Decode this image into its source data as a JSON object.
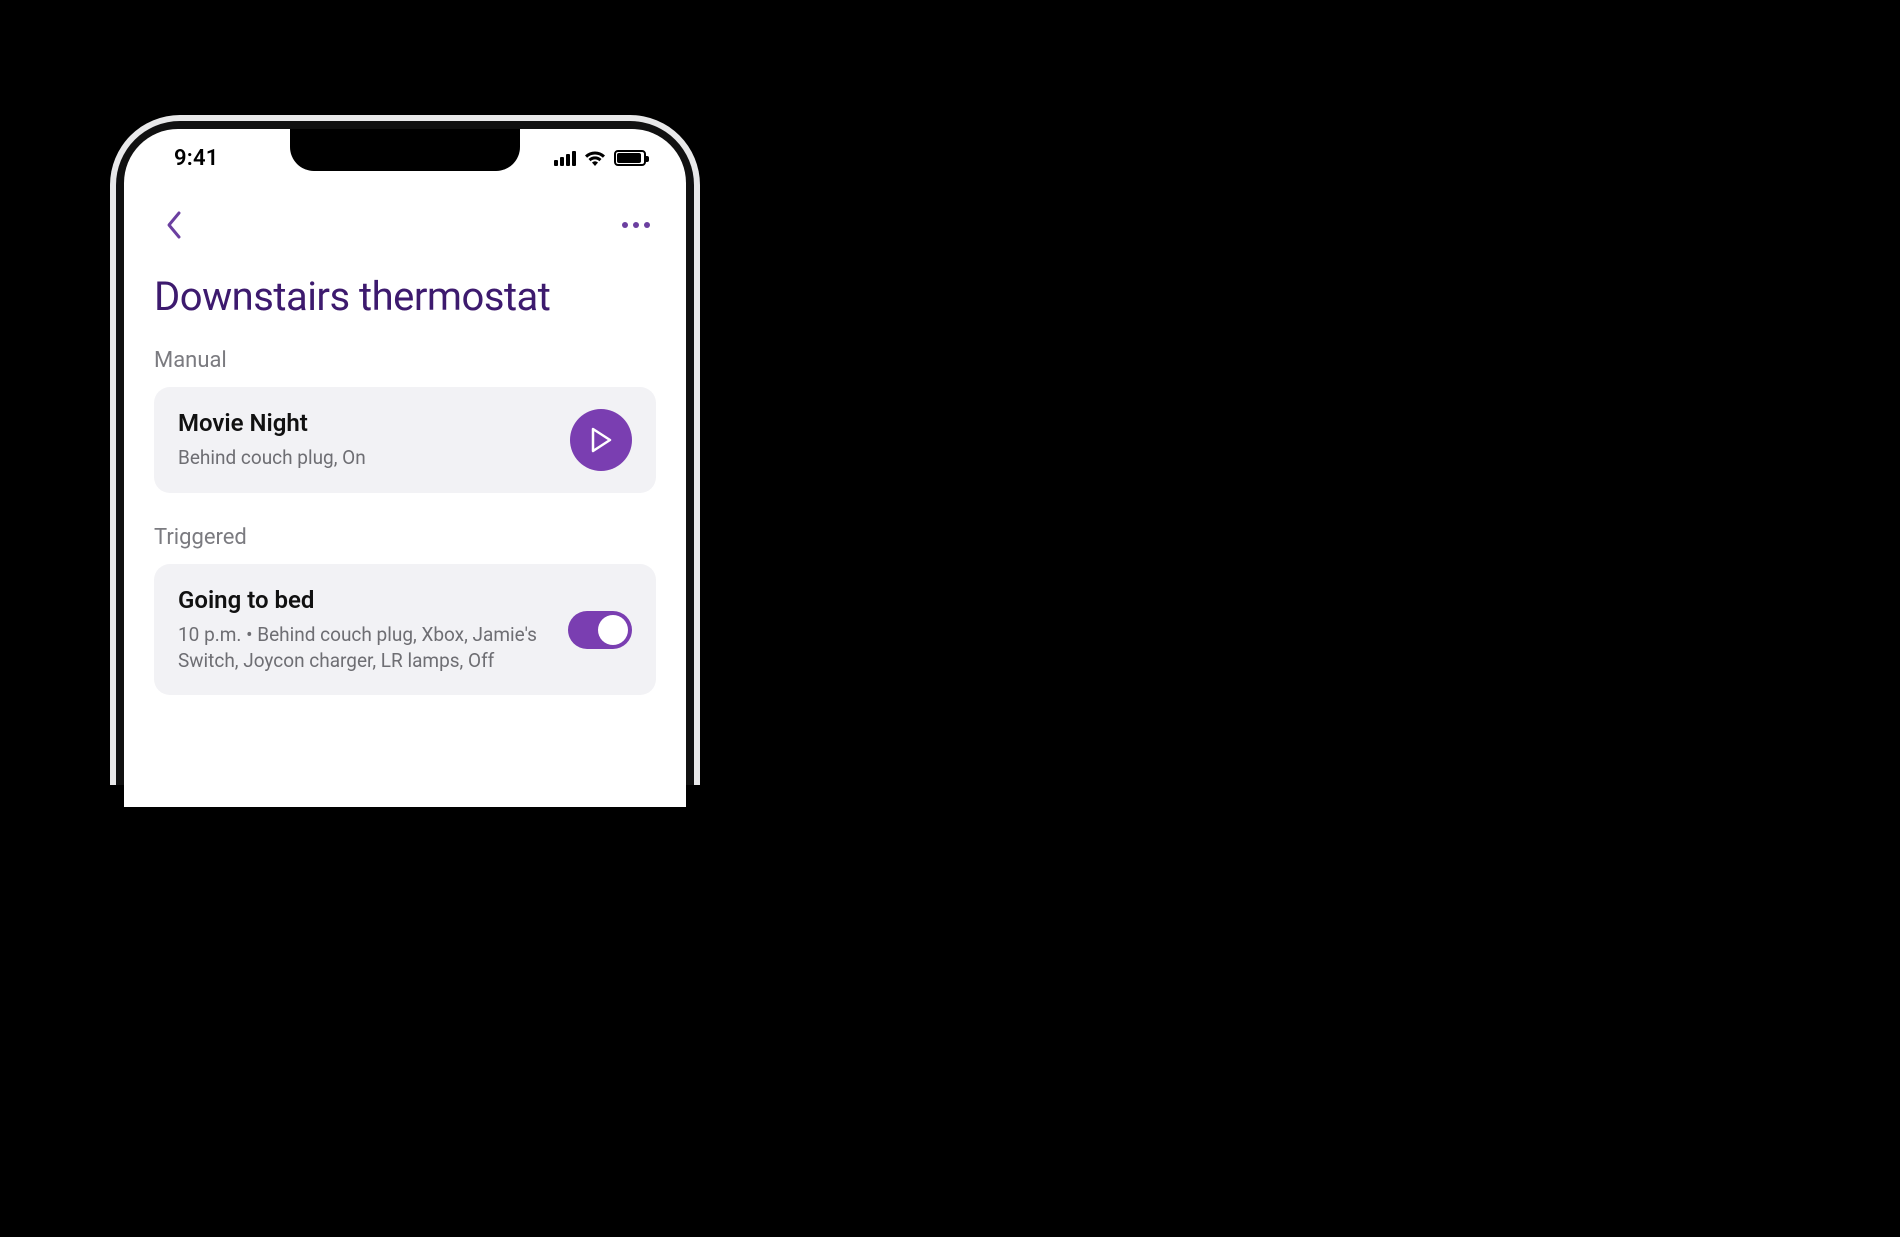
{
  "status_bar": {
    "time": "9:41"
  },
  "nav": {
    "back_icon": "chevron-left",
    "more_icon": "more-horizontal"
  },
  "page": {
    "title": "Downstairs thermostat"
  },
  "sections": {
    "manual": {
      "header": "Manual",
      "card": {
        "title": "Movie Night",
        "subtitle": "Behind couch plug, On",
        "action_icon": "play"
      }
    },
    "triggered": {
      "header": "Triggered",
      "card": {
        "title": "Going to bed",
        "subtitle": "10 p.m. • Behind couch plug, Xbox, Jamie's Switch, Joycon charger, LR lamps, Off",
        "toggle_on": true
      }
    }
  },
  "colors": {
    "accent": "#7a3eb1",
    "title": "#3d1a6e",
    "muted": "#6e6e73",
    "card_bg": "#f2f2f5"
  }
}
